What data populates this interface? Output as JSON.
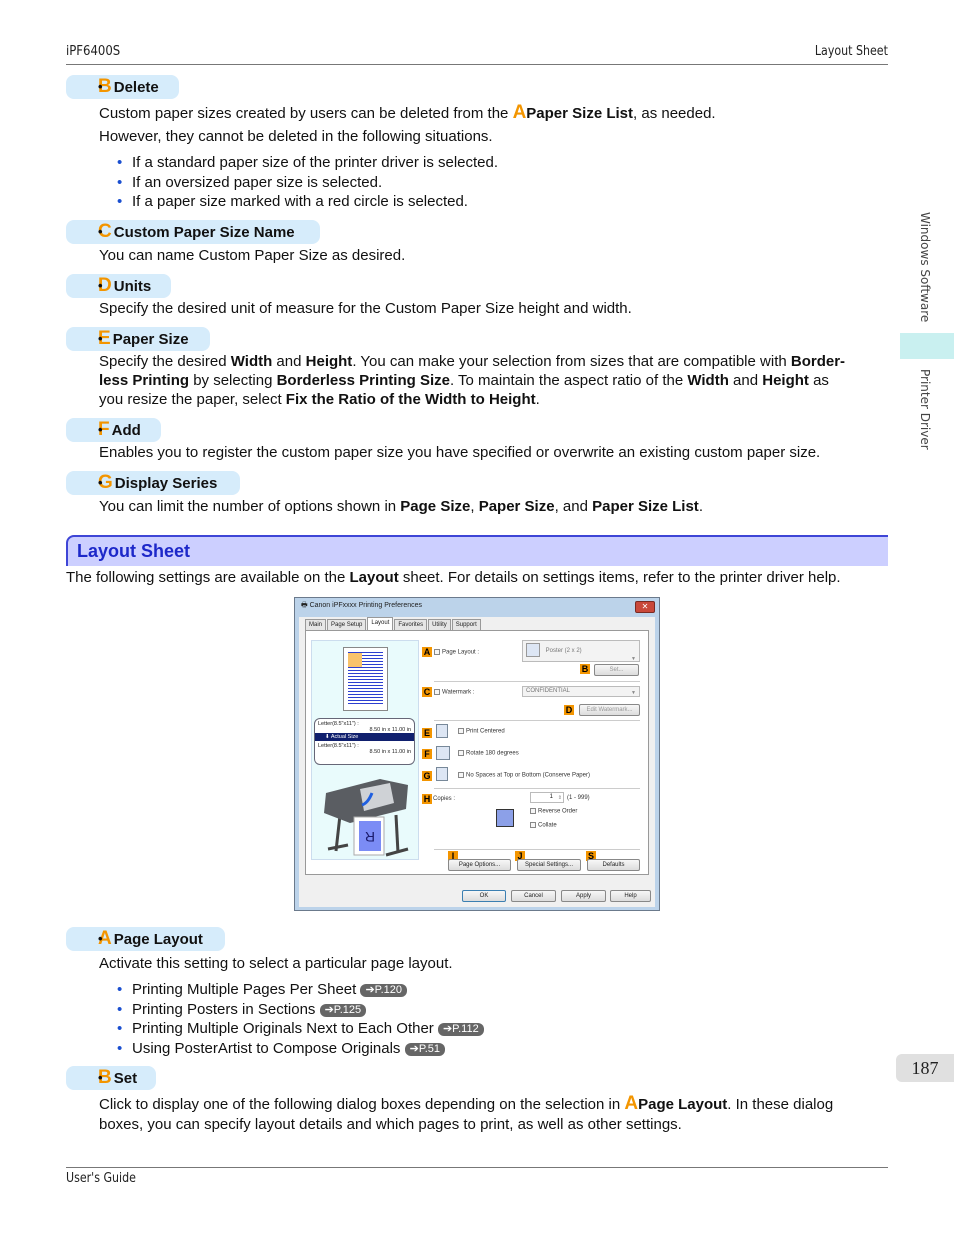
{
  "header": {
    "model": "iPF6400S",
    "section": "Layout Sheet"
  },
  "footer": {
    "guide": "User's Guide",
    "page_number": "187"
  },
  "side_tabs": {
    "category": "Windows Software",
    "subcategory": "Printer Driver"
  },
  "items_top": [
    {
      "letter": "B",
      "title": "Delete"
    },
    {
      "letter": "C",
      "title": "Custom Paper Size Name"
    },
    {
      "letter": "D",
      "title": "Units"
    },
    {
      "letter": "E",
      "title": "Paper Size"
    },
    {
      "letter": "F",
      "title": "Add"
    },
    {
      "letter": "G",
      "title": "Display Series"
    }
  ],
  "delete": {
    "p1_a": "Custom paper sizes created by users can be deleted from the ",
    "p1_letter": "A",
    "p1_b": "Paper Size List",
    "p1_c": ", as needed.",
    "p2": "However, they cannot be deleted in the following situations.",
    "bullets": [
      "If a standard paper size of the printer driver is selected.",
      "If an oversized paper size is selected.",
      "If a paper size marked with a red circle is selected."
    ]
  },
  "custom_name": {
    "text": "You can name Custom Paper Size as desired."
  },
  "units": {
    "text": "Specify the desired unit of measure for the Custom Paper Size height and width."
  },
  "paper_size": {
    "t1": "Specify the desired ",
    "b1": "Width",
    "t2": " and ",
    "b2": "Height",
    "t3": ". You can make your selection from sizes that are compatible with ",
    "b3": "Border-",
    "b3b": "less Printing",
    "t4": " by selecting ",
    "b4": "Borderless Printing Size",
    "t5": ". To maintain the aspect ratio of the ",
    "b5": "Width",
    "t6": " and ",
    "b6": "Height",
    "t7": " as",
    "t8": "you resize the paper, select ",
    "b7": "Fix the Ratio of the Width to Height",
    "t9": "."
  },
  "add": {
    "text": "Enables you to register the custom paper size you have specified or overwrite an existing custom paper size."
  },
  "display_series": {
    "t1": "You can limit the number of options shown in ",
    "b1": "Page Size",
    "t2": ", ",
    "b2": "Paper Size",
    "t3": ", and ",
    "b3": "Paper Size List",
    "t4": "."
  },
  "layout_section": {
    "title": "Layout Sheet",
    "intro_a": "The following settings are available on the ",
    "intro_b": "Layout",
    "intro_c": " sheet. For details on settings items, refer to the printer driver help."
  },
  "dialog": {
    "title": "Canon iPFxxxx Printing Preferences",
    "close": "✕",
    "tabs": [
      "Main",
      "Page Setup",
      "Layout",
      "Favorites",
      "Utility",
      "Support"
    ],
    "active_tab": "Layout",
    "preview": {
      "source_label": "Letter(8.5\"x11\") :",
      "source_size": "8.50 in x 11.00 in",
      "scale_mode": "Actual Size",
      "output_label": "Letter(8.5\"x11\") :",
      "output_size": "8.50 in x 11.00 in"
    },
    "page_layout": {
      "badge": "A",
      "label": "Page Layout :",
      "value": "Poster (2 x 2)"
    },
    "set_button": {
      "badge": "B",
      "label": "Set..."
    },
    "watermark": {
      "badge": "C",
      "label": "Watermark :",
      "value": "CONFIDENTIAL"
    },
    "edit_watermark": {
      "badge": "D",
      "label": "Edit Watermark..."
    },
    "print_centered": {
      "badge": "E",
      "label": "Print Centered"
    },
    "rotate": {
      "badge": "F",
      "label": "Rotate 180 degrees"
    },
    "no_spaces": {
      "badge": "G",
      "label": "No Spaces at Top or Bottom (Conserve Paper)"
    },
    "copies": {
      "badge": "H",
      "label": "Copies :",
      "value": "1",
      "range": "(1 - 999)"
    },
    "reverse_order": "Reverse Order",
    "collate": "Collate",
    "page_options": {
      "badge": "I",
      "label": "Page Options..."
    },
    "special_settings": {
      "badge": "J",
      "label": "Special Settings..."
    },
    "defaults": {
      "badge": "S",
      "label": "Defaults"
    },
    "buttons": {
      "ok": "OK",
      "cancel": "Cancel",
      "apply": "Apply",
      "help": "Help"
    }
  },
  "items_bottom": [
    {
      "letter": "A",
      "title": "Page Layout"
    },
    {
      "letter": "B",
      "title": "Set"
    }
  ],
  "page_layout_desc": {
    "text": "Activate this setting to select a particular page layout.",
    "links": [
      {
        "text": "Printing Multiple Pages Per Sheet",
        "ref": "➔P.120"
      },
      {
        "text": "Printing Posters in Sections",
        "ref": "➔P.125"
      },
      {
        "text": "Printing Multiple Originals Next to Each Other",
        "ref": "➔P.112"
      },
      {
        "text": "Using PosterArtist to Compose Originals",
        "ref": "➔P.51"
      }
    ]
  },
  "set_desc": {
    "t1": "Click to display one of the following dialog boxes depending on the selection in ",
    "letter": "A",
    "b1": "Page Layout",
    "t2": ". In these dialog",
    "t3": "boxes, you can specify layout details and which pages to print, as well as other settings."
  },
  "colors": {
    "accent_letter": "#f39500",
    "item_head_bg": "#d6ecfb",
    "section_bg": "#cccfff",
    "section_text": "#1d28c9",
    "bullet": "#1a4fd0"
  }
}
